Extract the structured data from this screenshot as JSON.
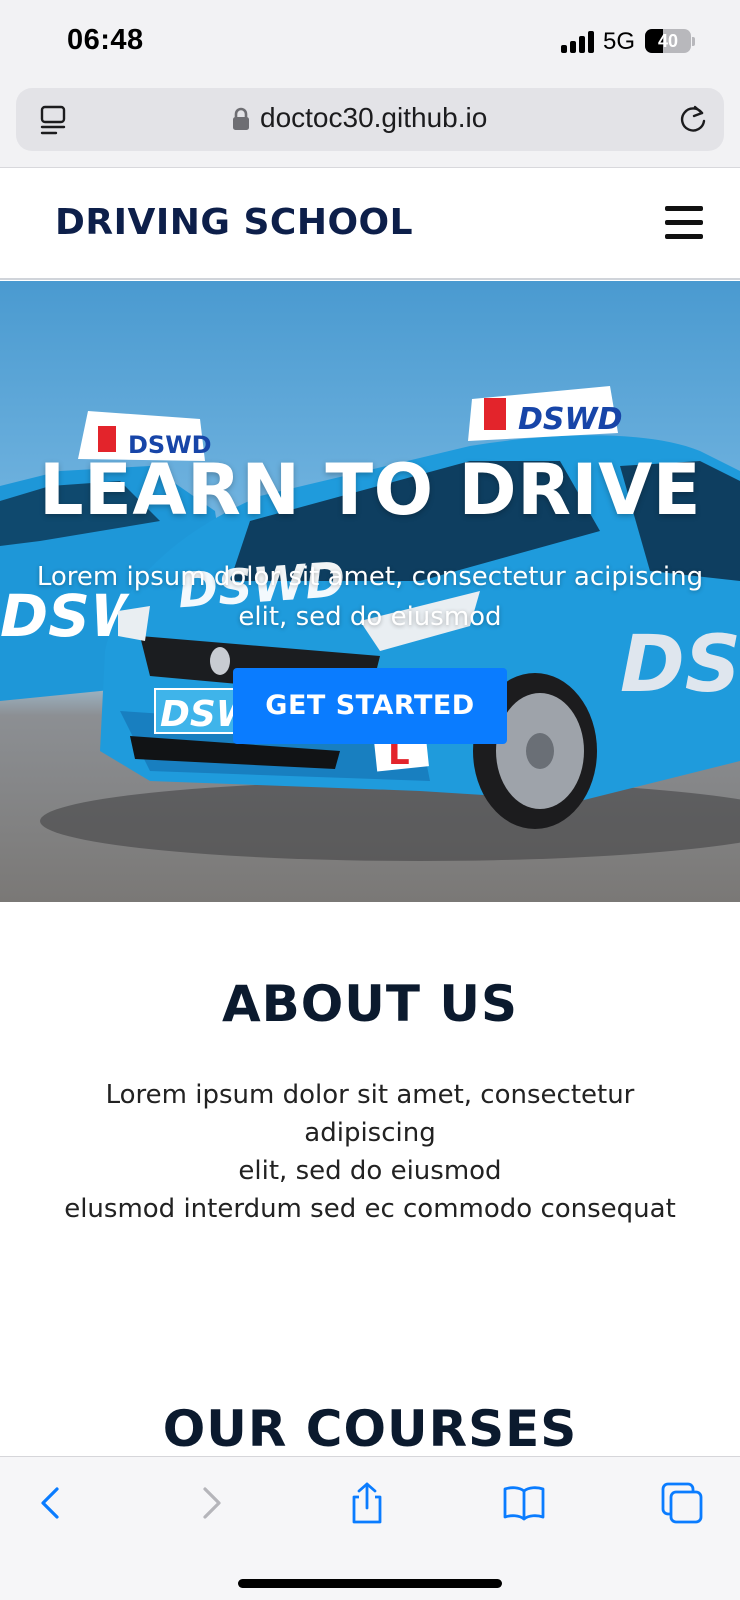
{
  "status_bar": {
    "time": "06:48",
    "network": "5G",
    "battery": "40",
    "battery_level": 0.4
  },
  "browser": {
    "url": "doctoc30.github.io"
  },
  "site": {
    "brand": "DRIVING SCHOOL"
  },
  "hero": {
    "title": "LEARN TO DRIVE",
    "subtitle": "Lorem ipsum dolor sit amet, consectetur acipiscing elit, sed do eiusmod",
    "cta_label": "GET STARTED",
    "image_brand_text": "DSWD",
    "image_plate_letter": "L"
  },
  "about": {
    "title": "ABOUT US",
    "line1": "Lorem ipsum dolor sit amet, consectetur adipiscing",
    "line2": "elit, sed do eiusmod",
    "line3": "elusmod interdum sed ec commodo consequat"
  },
  "courses": {
    "title": "OUR COURSES"
  },
  "colors": {
    "brand_navy": "#0d1f4a",
    "cta_blue": "#0a7cff",
    "ios_link_blue": "#0a7cff",
    "car_blue": "#1f9bdc"
  }
}
